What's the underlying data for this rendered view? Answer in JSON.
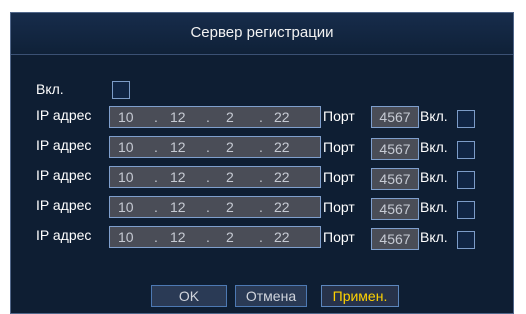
{
  "dialog": {
    "title": "Сервер регистрации",
    "enable_label": "Вкл.",
    "rows": [
      {
        "label": "IP адрес",
        "ip": [
          "10",
          "12",
          "2",
          "22"
        ],
        "port_label": "Порт",
        "port": "4567",
        "enable_label": "Вкл."
      },
      {
        "label": "IP адрес",
        "ip": [
          "10",
          "12",
          "2",
          "22"
        ],
        "port_label": "Порт",
        "port": "4567",
        "enable_label": "Вкл."
      },
      {
        "label": "IP адрес",
        "ip": [
          "10",
          "12",
          "2",
          "22"
        ],
        "port_label": "Порт",
        "port": "4567",
        "enable_label": "Вкл."
      },
      {
        "label": "IP адрес",
        "ip": [
          "10",
          "12",
          "2",
          "22"
        ],
        "port_label": "Порт",
        "port": "4567",
        "enable_label": "Вкл."
      },
      {
        "label": "IP адрес",
        "ip": [
          "10",
          "12",
          "2",
          "22"
        ],
        "port_label": "Порт",
        "port": "4567",
        "enable_label": "Вкл."
      }
    ],
    "buttons": {
      "ok": "OK",
      "cancel": "Отмена",
      "apply": "Примен."
    },
    "colors": {
      "background": "#0e1e33",
      "field": "#4a4d57",
      "field_border": "#7f9fcd",
      "apply_text": "#ffd200"
    }
  }
}
